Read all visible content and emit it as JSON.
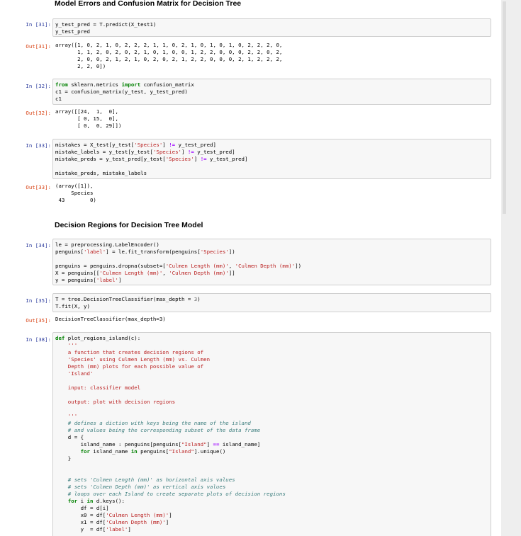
{
  "headings": {
    "errors": "Model Errors and Confusion Matrix for Decision Tree",
    "regions": "Decision Regions for Decision Tree Model"
  },
  "prompts": {
    "in31": "In [31]:",
    "out31": "Out[31]:",
    "in32": "In [32]:",
    "out32": "Out[32]:",
    "in33": "In [33]:",
    "out33": "Out[33]:",
    "in34": "In [34]:",
    "in35": "In [35]:",
    "out35": "Out[35]:",
    "in38": "In [38]:"
  },
  "cells": {
    "c31": "y_test_pred = T.predict(X_test1)\ny_test_pred",
    "c32": "from sklearn.metrics import confusion_matrix\nc1 = confusion_matrix(y_test, y_test_pred)\nc1",
    "c33": "mistakes = X_test[y_test['Species'] != y_test_pred]\nmistake_labels = y_test[y_test['Species'] != y_test_pred]\nmistake_preds = y_test_pred[y_test['Species'] != y_test_pred]\n\nmistake_preds, mistake_labels",
    "c34": "le = preprocessing.LabelEncoder()\npenguins['label'] = le.fit_transform(penguins['Species'])\n\npenguins = penguins.dropna(subset=['Culmen Length (mm)', 'Culmen Depth (mm)'])\nX = penguins[['Culmen Length (mm)', 'Culmen Depth (mm)']]\ny = penguins['label']",
    "c35": "T = tree.DecisionTreeClassifier(max_depth = 3)\nT.fit(X, y)",
    "c38": "def plot_regions_island(c):\n    '''\n    a function that creates decision regions of\n    'Species' using Culmen Length (mm) vs. Culmen\n    Depth (mm) plots for each possible value of\n    'Island'\n\n    input: classifier model\n\n    output: plot with decision regions\n\n    '''\n    # defines a diction with keys being the name of the island\n    # and values being the corresponding subset of the data frame\n    d = {\n        island_name : penguins[penguins[\"Island\"] == island_name]\n        for island_name in penguins[\"Island\"].unique()\n    }\n\n\n    # sets 'Culmen Length (mm)' as horizontal axis values\n    # sets 'Culmen Depth (mm)' as vertical axis values\n    # loops over each Island to create separate plots of decision regions\n    for i in d.keys():\n        df = d[i]\n        x0 = df['Culmen Length (mm)']\n        x1 = df['Culmen Depth (mm)']\n        y  = df['label']"
  },
  "outputs": {
    "o31": "array([1, 0, 2, 1, 0, 2, 2, 2, 1, 1, 0, 2, 1, 0, 1, 0, 1, 0, 2, 2, 2, 0,\n       1, 1, 2, 0, 2, 0, 2, 1, 0, 1, 0, 0, 1, 2, 2, 0, 0, 0, 2, 2, 0, 2,\n       2, 0, 0, 2, 1, 2, 1, 0, 2, 0, 2, 1, 2, 2, 0, 0, 0, 2, 1, 2, 2, 2,\n       2, 2, 0])",
    "o32": "array([[24,  1,  0],\n       [ 0, 15,  0],\n       [ 0,  0, 29]])",
    "o33": "(array([1]),\n     Species\n 43        0)",
    "o35": "DecisionTreeClassifier(max_depth=3)"
  }
}
